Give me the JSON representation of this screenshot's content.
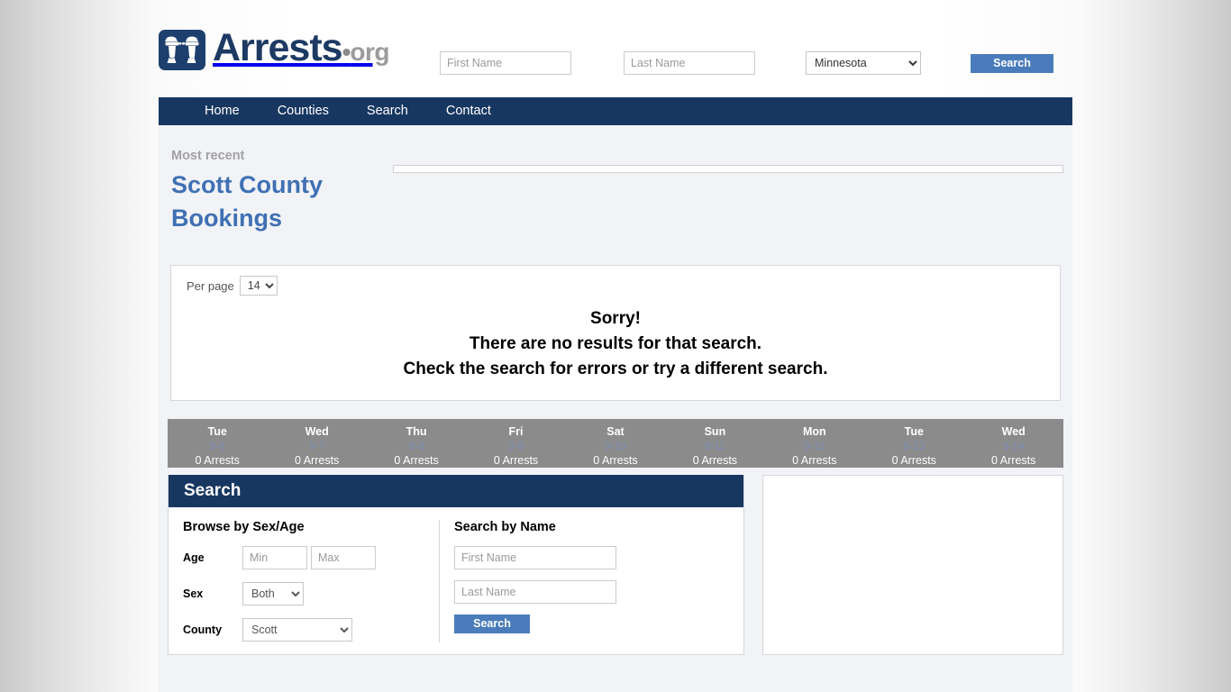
{
  "site": {
    "logo_name": "Arrests",
    "logo_dot": "•",
    "logo_suffix": "org",
    "logo_icon": "handcuffs-icon"
  },
  "header": {
    "first_name_placeholder": "First Name",
    "first_name_value": "",
    "last_name_placeholder": "Last Name",
    "last_name_value": "",
    "state_selected": "Minnesota",
    "state_options": [
      "Minnesota"
    ],
    "search_label": "Search",
    "search_button_color": "#4a7cbb"
  },
  "nav": {
    "items": [
      {
        "label": "Home"
      },
      {
        "label": "Counties"
      },
      {
        "label": "Search"
      },
      {
        "label": "Contact"
      }
    ],
    "background_color": "#173761"
  },
  "banner": {
    "eyebrow": "Most recent",
    "title_line1": "Scott County",
    "title_line2": "Bookings",
    "title_color": "#4070b4",
    "eyebrow_color": "#a2a2a2"
  },
  "results": {
    "per_page_label": "Per page",
    "per_page_selected": "14",
    "per_page_options": [
      "14"
    ],
    "message_line1": "Sorry!",
    "message_line2": "There are no results for that search.",
    "message_line3": "Check the search for errors or try a different search."
  },
  "date_strip": {
    "background_color": "#8b8b8b",
    "days": [
      {
        "day": "Tue",
        "date": "9-6",
        "count": "0 Arrests"
      },
      {
        "day": "Wed",
        "date": "9-7",
        "count": "0 Arrests"
      },
      {
        "day": "Thu",
        "date": "9-8",
        "count": "0 Arrests"
      },
      {
        "day": "Fri",
        "date": "9-9",
        "count": "0 Arrests"
      },
      {
        "day": "Sat",
        "date": "9-10",
        "count": "0 Arrests"
      },
      {
        "day": "Sun",
        "date": "9-11",
        "count": "0 Arrests"
      },
      {
        "day": "Mon",
        "date": "9-12",
        "count": "0 Arrests"
      },
      {
        "day": "Tue",
        "date": "9-13",
        "count": "0 Arrests"
      },
      {
        "day": "Wed",
        "date": "9-14",
        "count": "0 Arrests"
      }
    ]
  },
  "search_panel": {
    "title": "Search",
    "browse": {
      "heading": "Browse by Sex/Age",
      "age_label": "Age",
      "age_min_placeholder": "Min",
      "age_min_value": "",
      "age_max_placeholder": "Max",
      "age_max_value": "",
      "sex_label": "Sex",
      "sex_selected": "Both",
      "sex_options": [
        "Both"
      ],
      "county_label": "County",
      "county_selected": "Scott",
      "county_options": [
        "Scott"
      ]
    },
    "by_name": {
      "heading": "Search by Name",
      "first_name_placeholder": "First Name",
      "first_name_value": "",
      "last_name_placeholder": "Last Name",
      "last_name_value": "",
      "submit_label": "Search"
    }
  }
}
